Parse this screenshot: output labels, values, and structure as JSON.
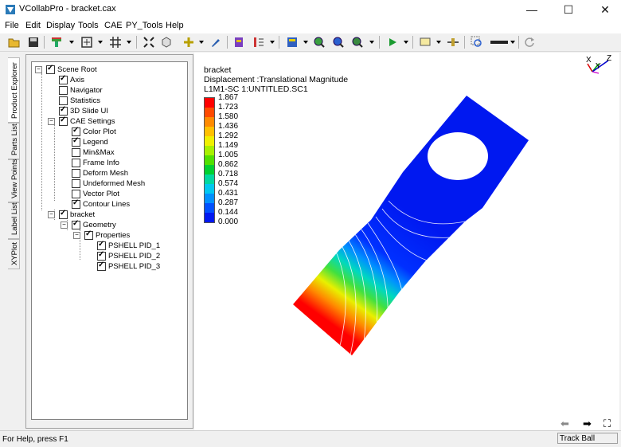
{
  "window": {
    "title": "VCollabPro - bracket.cax",
    "minimize": "—",
    "maximize": "☐",
    "close": "✕"
  },
  "menu": [
    "File",
    "Edit",
    "Display",
    "Tools",
    "CAE",
    "PY_Tools",
    "Help"
  ],
  "toolbar": {
    "icons": [
      "open-icon",
      "save-icon",
      "color-plot-icon",
      "fit-view-icon",
      "grid-icon",
      "explode-icon",
      "box-icon",
      "probe-icon",
      "paint-icon",
      "display-mode-icon",
      "legend-scale-icon",
      "color-map-icon",
      "zoom-in-icon",
      "zoom-fit-icon",
      "zoom-window-icon",
      "play-icon",
      "annotation-icon",
      "slider-icon",
      "search-zoom-icon",
      "line-style-icon",
      "refresh-icon"
    ]
  },
  "side_tabs": [
    "Product Explorer",
    "Parts List",
    "View Points",
    "Label List",
    "XYPlot"
  ],
  "tree": {
    "scene_root": "Scene Root",
    "axis": "Axis",
    "navigator": "Navigator",
    "statistics": "Statistics",
    "slide_ui": "3D Slide UI",
    "cae_settings": "CAE Settings",
    "color_plot": "Color Plot",
    "legend": "Legend",
    "minmax": "Min&Max",
    "frame_info": "Frame Info",
    "deform_mesh": "Deform Mesh",
    "undeformed_mesh": "Undeformed Mesh",
    "vector_plot": "Vector Plot",
    "contour_lines": "Contour Lines",
    "bracket": "bracket",
    "geometry": "Geometry",
    "properties": "Properties",
    "pshell1": "PSHELL PID_1",
    "pshell2": "PSHELL PID_2",
    "pshell3": "PSHELL PID_3"
  },
  "viewport": {
    "model_name": "bracket",
    "result": "Displacement :Translational Magnitude",
    "loadcase": "L1M1-SC 1:UNTITLED.SC1",
    "legend_values": [
      "1.867",
      "1.723",
      "1.580",
      "1.436",
      "1.292",
      "1.149",
      "1.005",
      "0.862",
      "0.718",
      "0.574",
      "0.431",
      "0.287",
      "0.144",
      "0.000"
    ],
    "legend_colors": [
      "#ff0000",
      "#ff4a00",
      "#ff8a00",
      "#ffc000",
      "#f0f000",
      "#a8f000",
      "#50e000",
      "#00d030",
      "#00d8a0",
      "#00c8f0",
      "#0090ff",
      "#0050ff",
      "#0018f0"
    ],
    "axis_labels": {
      "x": "X",
      "y": "Y",
      "z": "Z"
    },
    "prev": "⬅",
    "next": "➡",
    "fullscreen": "⛶"
  },
  "status": {
    "help": "For Help, press F1",
    "mode": "Track Ball"
  }
}
